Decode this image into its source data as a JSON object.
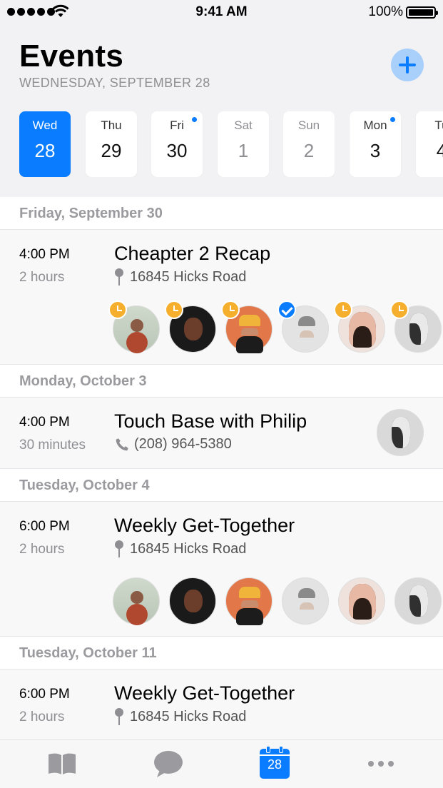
{
  "status_bar": {
    "time": "9:41 AM",
    "battery": "100%"
  },
  "header": {
    "title": "Events",
    "subtitle": "WEDNESDAY, SEPTEMBER 28"
  },
  "days": [
    {
      "name": "Wed",
      "num": "28"
    },
    {
      "name": "Thu",
      "num": "29"
    },
    {
      "name": "Fri",
      "num": "30"
    },
    {
      "name": "Sat",
      "num": "1"
    },
    {
      "name": "Sun",
      "num": "2"
    },
    {
      "name": "Mon",
      "num": "3"
    },
    {
      "name": "Tu",
      "num": "4"
    }
  ],
  "sections": [
    {
      "header": "Friday, September 30"
    },
    {
      "header": "Monday, October 3"
    },
    {
      "header": "Tuesday, October 4"
    },
    {
      "header": "Tuesday, October 11"
    }
  ],
  "events": [
    {
      "time": "4:00 PM",
      "duration": "2 hours",
      "title": "Cheapter 2 Recap",
      "detail": "16845 Hicks Road"
    },
    {
      "time": "4:00 PM",
      "duration": "30 minutes",
      "title": "Touch Base with Philip",
      "detail": "(208) 964-5380"
    },
    {
      "time": "6:00 PM",
      "duration": "2 hours",
      "title": "Weekly Get-Together",
      "detail": "16845 Hicks Road"
    },
    {
      "time": "6:00 PM",
      "duration": "2 hours",
      "title": "Weekly Get-Together",
      "detail": "16845 Hicks Road"
    }
  ],
  "tab_bar": {
    "calendar_day": "28"
  },
  "colors": {
    "accent": "#0a7cff",
    "pending": "#f6ae2d"
  },
  "icons": [
    "add-icon",
    "map-pin-icon",
    "phone-icon",
    "clock-icon",
    "checkmark-icon",
    "book-icon",
    "chat-bubble-icon",
    "calendar-icon",
    "more-icon"
  ]
}
